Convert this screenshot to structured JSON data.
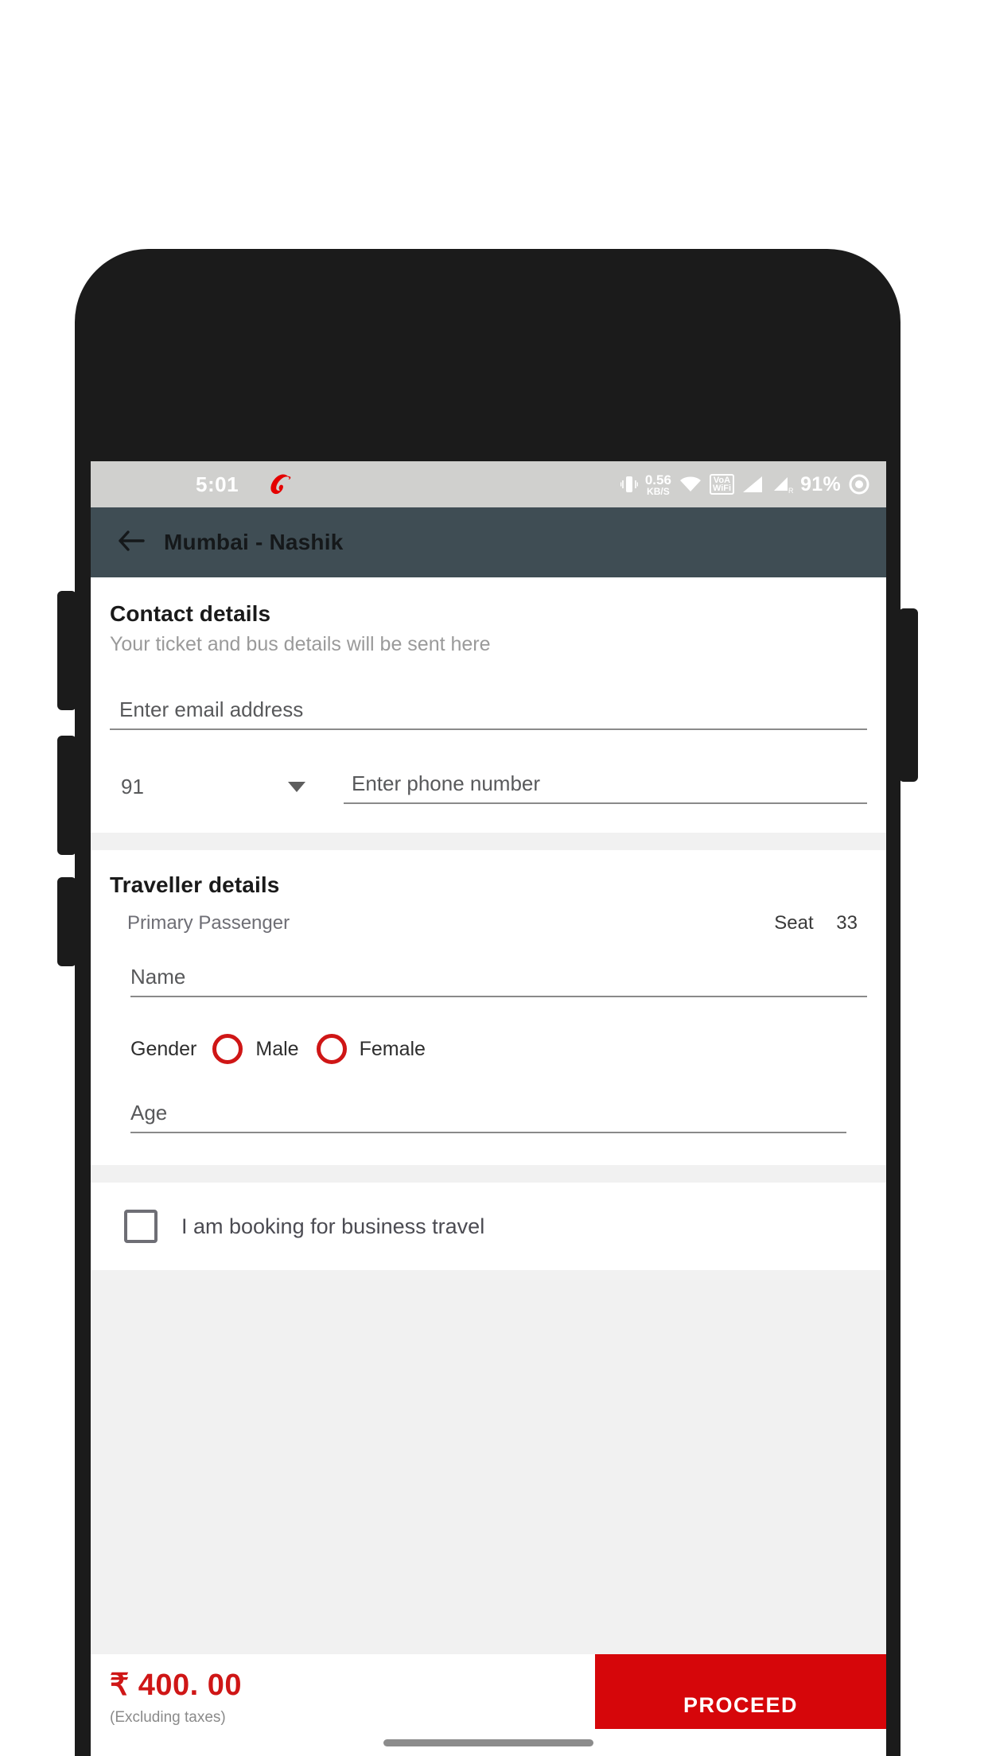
{
  "status_bar": {
    "clock": "5:01",
    "carrier_logo": "airtel-logo-icon",
    "net_speed_value": "0.56",
    "net_speed_unit": "KB/S",
    "vowifi_top": "VoA",
    "vowifi_bottom": "WiFi",
    "battery_percent": "91%",
    "icons": [
      "vibrate-icon",
      "wifi-icon",
      "vowifi-icon",
      "signal-bars-icon",
      "signal-bars-roaming-icon",
      "alarm-icon"
    ],
    "bg_color": "#d0d0ce"
  },
  "app_bar": {
    "back_icon": "back-arrow-icon",
    "title": "Mumbai - Nashik",
    "bg_color": "#3f4d54"
  },
  "contact": {
    "title": "Contact details",
    "subtitle": "Your ticket and bus details will be sent here",
    "email_placeholder": "Enter email address",
    "email_value": "",
    "country_code": "91",
    "phone_placeholder": "Enter phone number",
    "phone_value": ""
  },
  "traveller": {
    "title": "Traveller details",
    "passenger_label": "Primary Passenger",
    "seat_label": "Seat",
    "seat_number": "33",
    "name_placeholder": "Name",
    "name_value": "",
    "gender_label": "Gender",
    "gender_options": [
      "Male",
      "Female"
    ],
    "gender_selected": "",
    "age_placeholder": "Age",
    "age_value": ""
  },
  "business": {
    "label": "I am booking for business travel",
    "checked": false
  },
  "bottom": {
    "price": "₹ 400. 00",
    "price_note": "(Excluding taxes)",
    "proceed_label": "PROCEED",
    "accent_color": "#d6060a",
    "price_color": "#cf1616"
  }
}
